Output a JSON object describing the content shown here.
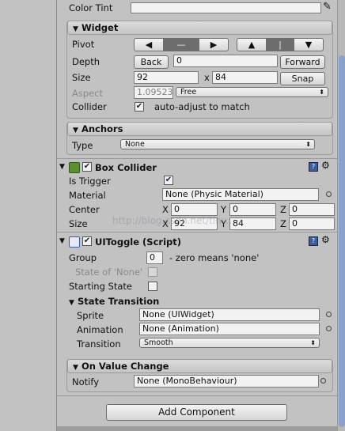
{
  "color_tint": {
    "label": "Color Tint"
  },
  "widget": {
    "title": "Widget",
    "pivot_label": "Pivot",
    "pivot_buttons": [
      "◀",
      "—",
      "▶",
      "▲",
      "|",
      "▼"
    ],
    "depth_label": "Depth",
    "back_label": "Back",
    "depth_value": "0",
    "forward_label": "Forward",
    "size_label": "Size",
    "size_w": "92",
    "size_x": "x",
    "size_h": "84",
    "snap_label": "Snap",
    "aspect_label": "Aspect",
    "aspect_value": "1.09523",
    "aspect_mode": "Free",
    "collider_label": "Collider",
    "collider_text": "auto-adjust to match"
  },
  "anchors": {
    "title": "Anchors",
    "type_label": "Type",
    "type_value": "None"
  },
  "box_collider": {
    "title": "Box Collider",
    "is_trigger_label": "Is Trigger",
    "material_label": "Material",
    "material_value": "None (Physic Material)",
    "center_label": "Center",
    "size_label": "Size",
    "x": "X",
    "y": "Y",
    "z": "Z",
    "center": [
      "0",
      "0",
      "0"
    ],
    "size": [
      "92",
      "84",
      "0"
    ]
  },
  "uitoggle": {
    "title": "UIToggle (Script)",
    "group_label": "Group",
    "group_value": "0",
    "group_hint": "- zero means 'none'",
    "state_none_label": "State of 'None'",
    "starting_state_label": "Starting State",
    "state_transition_title": "State Transition",
    "sprite_label": "Sprite",
    "sprite_value": "None (UIWidget)",
    "animation_label": "Animation",
    "animation_value": "None (Animation)",
    "transition_label": "Transition",
    "transition_value": "Smooth",
    "on_value_change_title": "On Value Change",
    "notify_label": "Notify",
    "notify_value": "None (MonoBehaviour)"
  },
  "add_component_label": "Add Component",
  "watermark": "http://blog.csdn.net/tiny...",
  "colors": {
    "accent": "#3b5f9e",
    "thumb": "#8aa1c9"
  }
}
